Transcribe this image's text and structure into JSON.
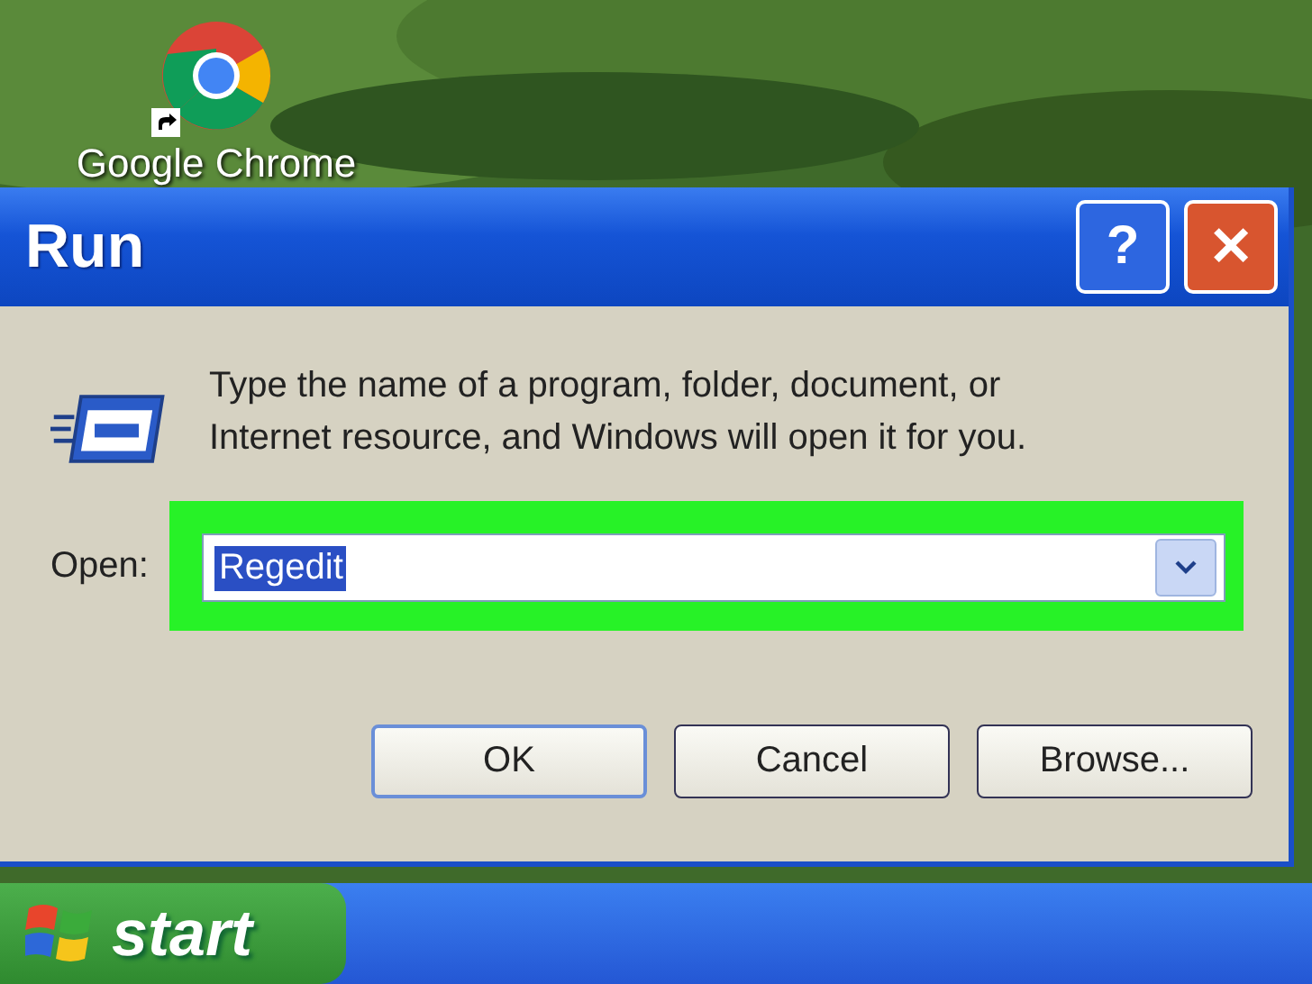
{
  "desktop_icons": [
    {
      "label": "Google Chrome",
      "shortcut": true
    }
  ],
  "window": {
    "title": "Run",
    "title_buttons": [
      {
        "kind": "help",
        "label": "?"
      },
      {
        "kind": "close",
        "label": "✕"
      }
    ],
    "prompt": "Type the name of a program, folder, document, or Internet resource, and Windows will open it for you.",
    "open_field": {
      "label": "Open:",
      "value": "Regedit",
      "text_selected": true,
      "highlighted": true
    },
    "buttons": [
      {
        "label": "OK",
        "default": true
      },
      {
        "label": "Cancel",
        "default": false
      },
      {
        "label": "Browse...",
        "default": false
      }
    ]
  },
  "taskbar": {
    "start_label": "start"
  }
}
